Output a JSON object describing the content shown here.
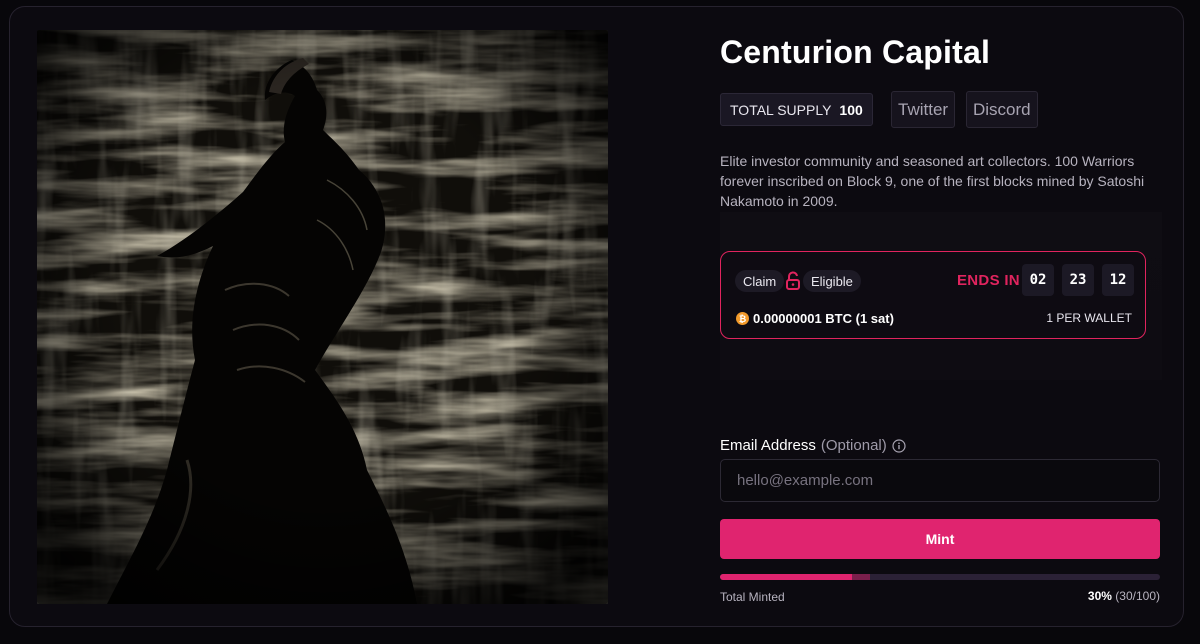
{
  "collection": {
    "title": "Centurion Capital",
    "supply_label": "TOTAL SUPPLY",
    "supply_value": "100",
    "twitter_label": "Twitter",
    "discord_label": "Discord",
    "description": "Elite investor community and seasoned art collectors. 100 Warriors forever inscribed on Block 9, one of the first blocks mined by Satoshi Nakamoto in 2009."
  },
  "phase": {
    "claim_label": "Claim",
    "eligible_label": "Eligible",
    "lock_icon": "unlock-icon",
    "ends_label": "ENDS IN",
    "countdown": [
      "02",
      "23",
      "12"
    ],
    "price": "0.00000001 BTC (1 sat)",
    "coin_icon": "bitcoin-icon",
    "limit": "1 PER WALLET"
  },
  "email": {
    "label": "Email Address",
    "optional": "(Optional)",
    "placeholder": "hello@example.com"
  },
  "mint": {
    "button_label": "Mint",
    "progress_label": "Total Minted",
    "percent": "30%",
    "count": "(30/100)",
    "fraction_minted": 0.3
  },
  "colors": {
    "accent": "#e0246f",
    "phase_border": "#e0245e",
    "background": "#0c0a10"
  }
}
